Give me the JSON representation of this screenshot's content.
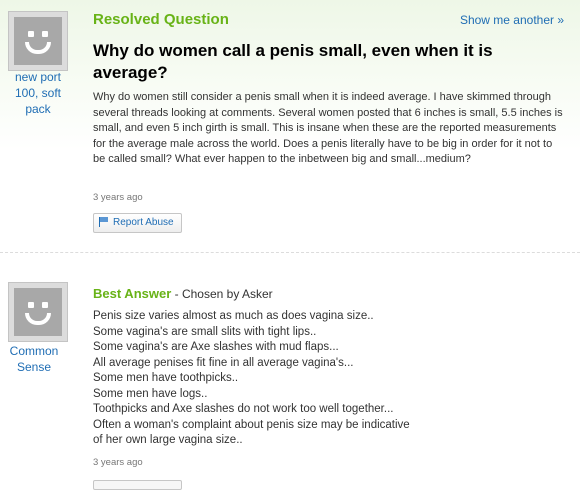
{
  "question": {
    "status_label": "Resolved Question",
    "show_another": "Show me another »",
    "asker_name": "new port 100, soft pack",
    "title": "Why do women call a penis small, even when it is average?",
    "body": "Why do women still consider a penis small when it is indeed average. I have skimmed through several threads looking at comments. Several women posted that 6 inches is small, 5.5 inches is small, and even 5 inch girth is small. This is insane when these are the reported measurements for the average male across the world. Does a penis literally have to be big in order for it not to be called small? What ever happen to the inbetween big and small...medium?",
    "timestamp": "3 years ago",
    "report_label": "Report Abuse"
  },
  "best_answer": {
    "label": "Best Answer",
    "chosen_by": " - Chosen by Asker",
    "answerer_name": "Common Sense",
    "lines": [
      "Penis size varies almost as much as does vagina size..",
      "Some vagina's are small slits with tight lips..",
      "Some vagina's are Axe slashes with mud flaps...",
      "All average penises fit fine in all average vagina's...",
      "Some men have toothpicks..",
      "Some men have logs..",
      "Toothpicks and Axe slashes do not work too well together...",
      "Often a woman's complaint about penis size may be indicative",
      "of her own large vagina size.."
    ],
    "timestamp": "3 years ago"
  },
  "colors": {
    "accent_green": "#68b317",
    "link_blue": "#1f6db4"
  },
  "icons": [
    "default-avatar-icon",
    "flag-icon"
  ]
}
